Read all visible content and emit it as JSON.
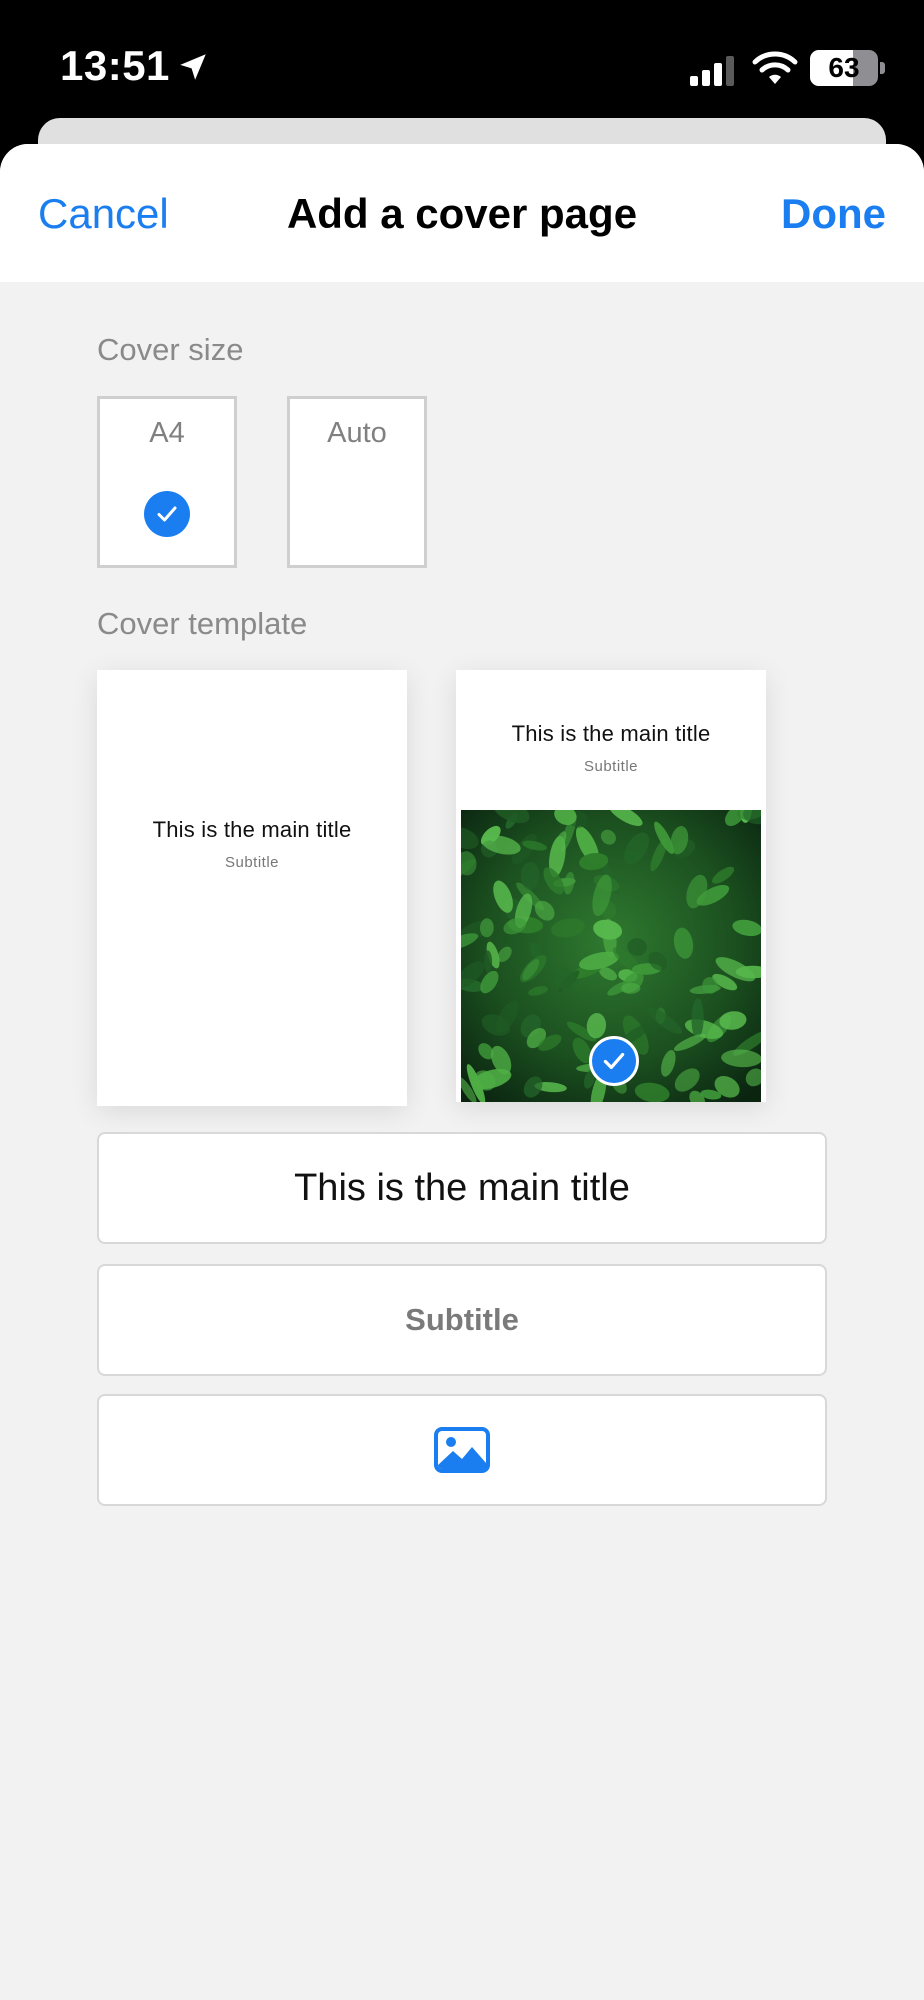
{
  "status_bar": {
    "time": "13:51",
    "battery_level": "63",
    "battery_fraction": 0.63,
    "icons": [
      "location-arrow-icon",
      "cellular-signal-icon",
      "wifi-icon",
      "battery-icon"
    ]
  },
  "nav": {
    "cancel_label": "Cancel",
    "title": "Add a cover page",
    "done_label": "Done"
  },
  "cover_size": {
    "section_label": "Cover size",
    "options": [
      {
        "label": "A4",
        "selected": true
      },
      {
        "label": "Auto",
        "selected": false
      }
    ]
  },
  "cover_template": {
    "section_label": "Cover template",
    "templates": [
      {
        "title": "This is the main title",
        "subtitle": "Subtitle",
        "has_image": false,
        "selected": false
      },
      {
        "title": "This is the main title",
        "subtitle": "Subtitle",
        "has_image": true,
        "selected": true
      }
    ]
  },
  "form": {
    "title_value": "This is the main title",
    "subtitle_placeholder": "Subtitle",
    "image_button_icon": "image-icon"
  },
  "colors": {
    "accent": "#1a7ef0",
    "sheet_background": "#f2f2f2",
    "label_gray": "#8a8a8a"
  }
}
